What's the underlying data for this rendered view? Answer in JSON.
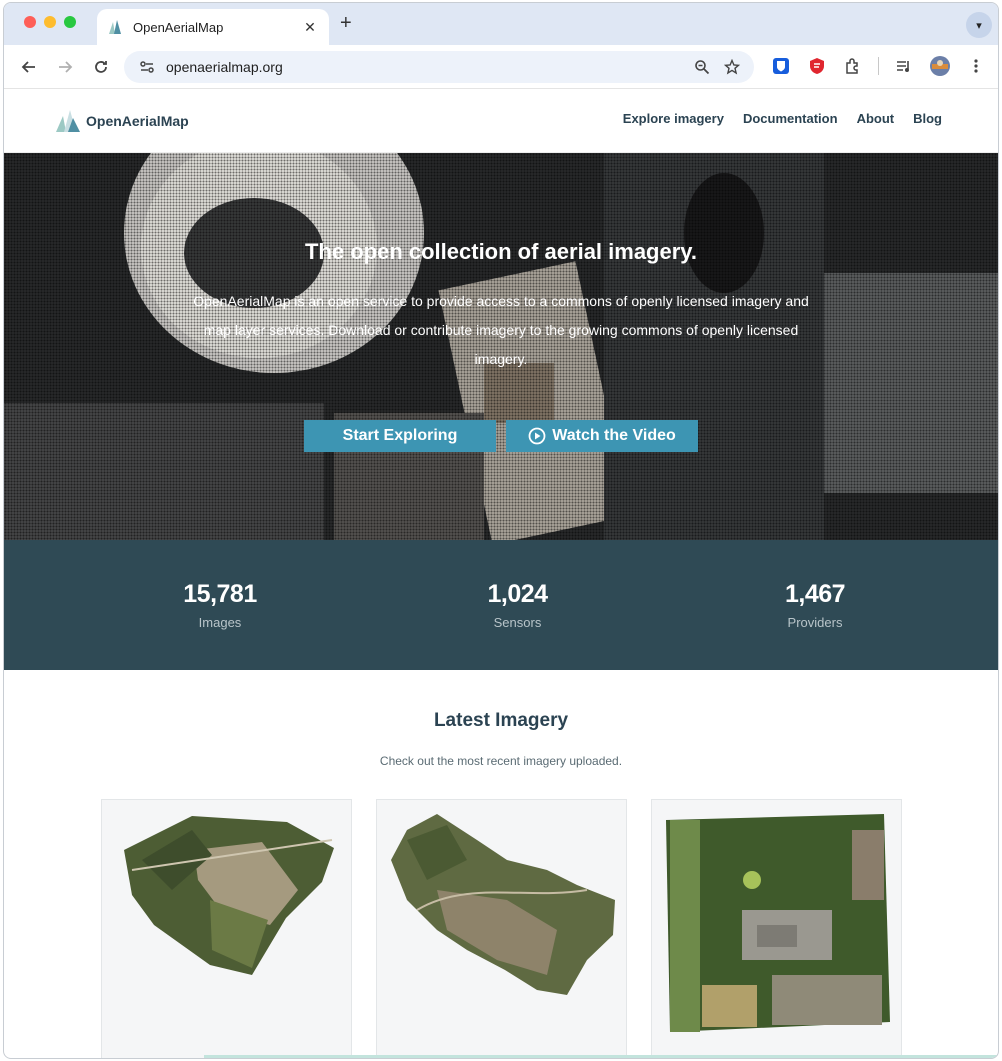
{
  "browser": {
    "tab_title": "OpenAerialMap",
    "url": "openaerialmap.org"
  },
  "site": {
    "logo_text": "OpenAerialMap",
    "nav": [
      "Explore imagery",
      "Documentation",
      "About",
      "Blog"
    ]
  },
  "hero": {
    "title": "The open collection of aerial imagery.",
    "description": "OpenAerialMap is an open service to provide access to a commons of openly licensed imagery and map layer services. Download or contribute imagery to the growing commons of openly licensed imagery.",
    "primary_button": "Start Exploring",
    "secondary_button": "Watch the Video"
  },
  "stats": [
    {
      "value": "15,781",
      "label": "Images"
    },
    {
      "value": "1,024",
      "label": "Sensors"
    },
    {
      "value": "1,467",
      "label": "Providers"
    }
  ],
  "latest": {
    "title": "Latest Imagery",
    "subtitle": "Check out the most recent imagery uploaded."
  },
  "colors": {
    "brand_dark": "#2b4352",
    "button": "#3d95b3",
    "stats_bg": "#2f4a55"
  },
  "icons": [
    "search-icon",
    "star-icon",
    "bitwarden-icon",
    "shield-icon",
    "extensions-icon",
    "media-icon",
    "avatar",
    "menu-icon",
    "play-circle-icon"
  ]
}
